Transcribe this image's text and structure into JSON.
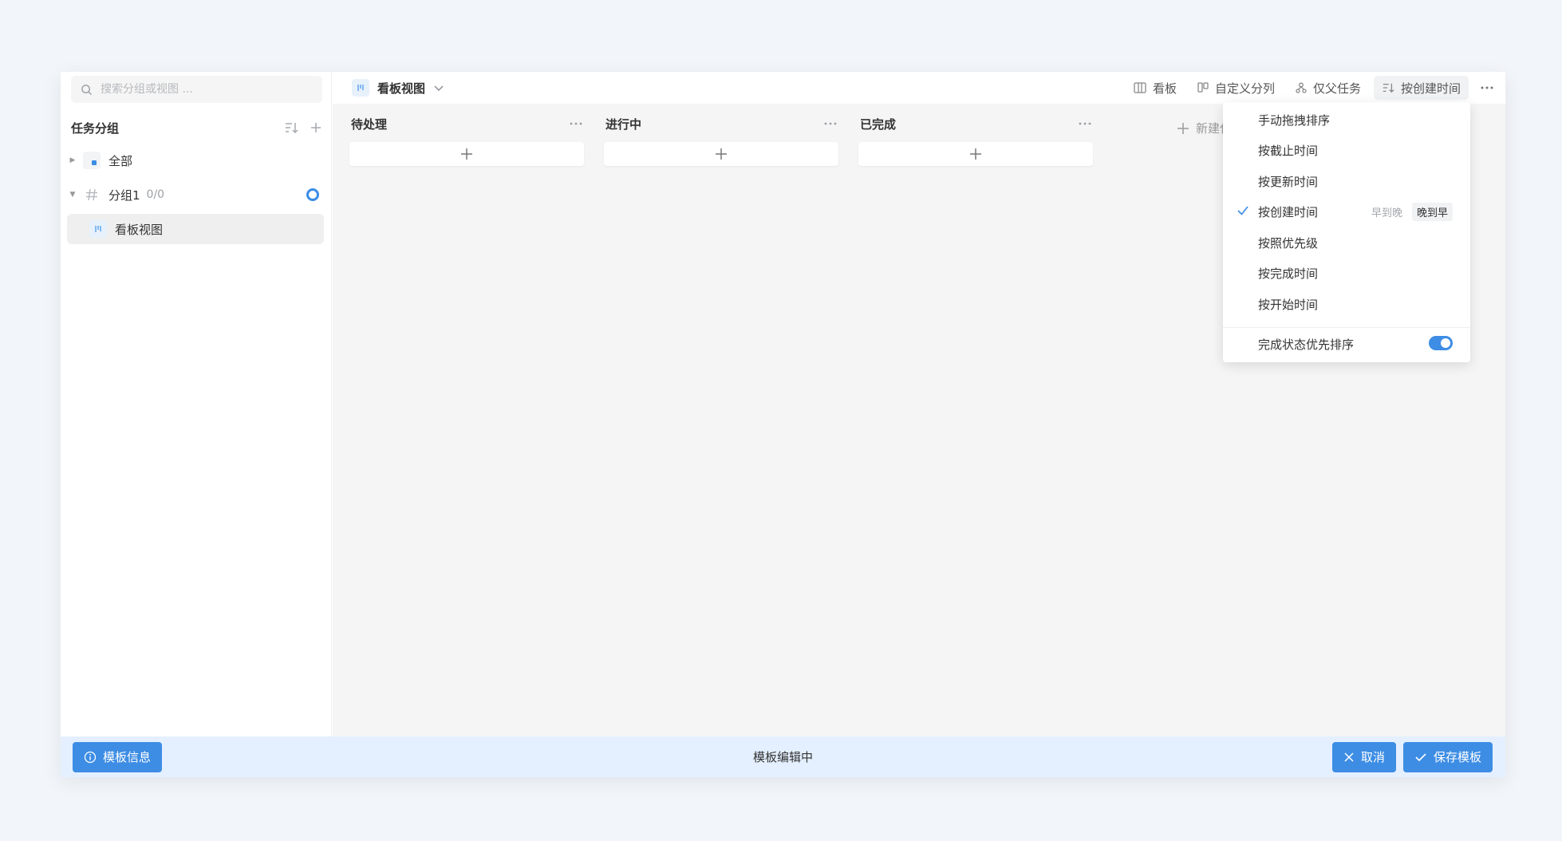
{
  "sidebar": {
    "search_placeholder": "搜索分组或视图 ...",
    "title": "任务分组",
    "items": [
      {
        "label": "全部"
      },
      {
        "label": "分组1",
        "count": "0/0"
      },
      {
        "label": "看板视图"
      }
    ]
  },
  "header": {
    "view_title": "看板视图",
    "toolbar": [
      {
        "label": "看板",
        "icon": "board-icon"
      },
      {
        "label": "自定义分列",
        "icon": "columns-icon"
      },
      {
        "label": "仅父任务",
        "icon": "hierarchy-icon"
      },
      {
        "label": "按创建时间",
        "icon": "sort-icon"
      }
    ]
  },
  "columns": [
    {
      "title": "待处理"
    },
    {
      "title": "进行中"
    },
    {
      "title": "已完成"
    }
  ],
  "new_list_label": "新建任务列表",
  "sort_menu": {
    "items": [
      {
        "label": "手动拖拽排序"
      },
      {
        "label": "按截止时间"
      },
      {
        "label": "按更新时间"
      },
      {
        "label": "按创建时间",
        "checked": true
      },
      {
        "label": "按照优先级"
      },
      {
        "label": "按完成时间"
      },
      {
        "label": "按开始时间"
      }
    ],
    "order_options": [
      "早到晚",
      "晚到早"
    ],
    "order_selected": "晚到早",
    "toggle_label": "完成状态优先排序",
    "toggle_on": true
  },
  "bottom": {
    "info_button": "模板信息",
    "status": "模板编辑中",
    "cancel_button": "取消",
    "save_button": "保存模板"
  },
  "colors": {
    "accent": "#3d8de4",
    "bottom_bar": "#e4efff",
    "board_bg": "#f5f5f5"
  }
}
